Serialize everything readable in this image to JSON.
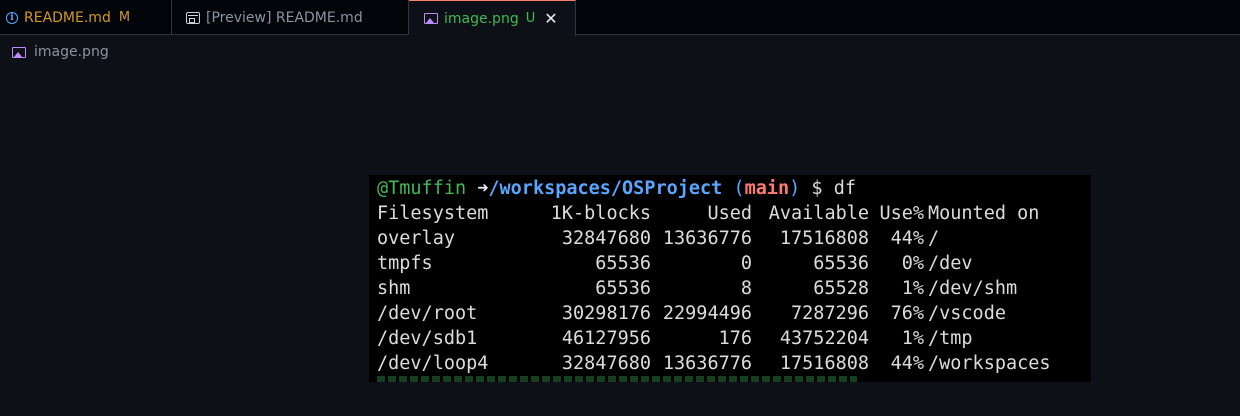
{
  "tabs": [
    {
      "label": "README.md",
      "badge": "M",
      "icon": "info-icon"
    },
    {
      "label": "[Preview] README.md",
      "icon": "preview-icon"
    },
    {
      "label": "image.png",
      "badge": "U",
      "icon": "image-icon",
      "active": true,
      "close": "✕"
    }
  ],
  "breadcrumb": {
    "label": "image.png",
    "icon": "image-icon"
  },
  "terminal": {
    "prompt_user": "@Tmuffin",
    "prompt_arrow": "➜",
    "prompt_path": "/workspaces/OSProject",
    "prompt_branch_open": "(",
    "prompt_branch": "main",
    "prompt_branch_close": ")",
    "prompt_symbol": "$",
    "command": "df",
    "headers": {
      "filesystem": "Filesystem",
      "blocks": "1K-blocks",
      "used": "Used",
      "available": "Available",
      "use_pct": "Use%",
      "mounted": "Mounted on"
    },
    "rows": [
      {
        "filesystem": "overlay",
        "blocks": "32847680",
        "used": "13636776",
        "available": "17516808",
        "use_pct": "44%",
        "mounted": "/"
      },
      {
        "filesystem": "tmpfs",
        "blocks": "65536",
        "used": "0",
        "available": "65536",
        "use_pct": "0%",
        "mounted": "/dev"
      },
      {
        "filesystem": "shm",
        "blocks": "65536",
        "used": "8",
        "available": "65528",
        "use_pct": "1%",
        "mounted": "/dev/shm"
      },
      {
        "filesystem": "/dev/root",
        "blocks": "30298176",
        "used": "22994496",
        "available": "7287296",
        "use_pct": "76%",
        "mounted": "/vscode"
      },
      {
        "filesystem": "/dev/sdb1",
        "blocks": "46127956",
        "used": "176",
        "available": "43752204",
        "use_pct": "1%",
        "mounted": "/tmp"
      },
      {
        "filesystem": "/dev/loop4",
        "blocks": "32847680",
        "used": "13636776",
        "available": "17516808",
        "use_pct": "44%",
        "mounted": "/workspaces"
      }
    ]
  },
  "colors": {
    "background": "#0d1117",
    "modified": "#d29922",
    "untracked": "#3fb950",
    "prompt_path": "#58a6ff",
    "branch": "#ff7b72"
  }
}
